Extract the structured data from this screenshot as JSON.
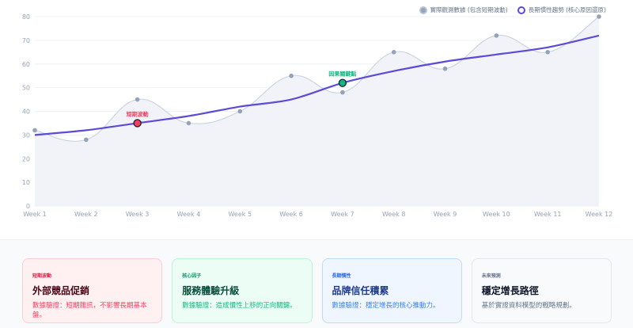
{
  "chart_data": {
    "type": "line",
    "categories": [
      "Week 1",
      "Week 2",
      "Week 3",
      "Week 4",
      "Week 5",
      "Week 6",
      "Week 7",
      "Week 8",
      "Week 9",
      "Week 10",
      "Week 11",
      "Week 12"
    ],
    "yticks": [
      0,
      10,
      20,
      30,
      40,
      50,
      60,
      70,
      80
    ],
    "ylim": [
      0,
      80
    ],
    "grid": true,
    "legend_position": "top-right",
    "series": [
      {
        "name": "實際觀測數據 (包含短期波動)",
        "values": [
          32,
          28,
          45,
          35,
          40,
          55,
          48,
          65,
          58,
          72,
          65,
          80
        ],
        "color": "#94a3b8",
        "style": "smooth-area"
      },
      {
        "name": "長期慣性趨勢 (核心原因還原)",
        "values": [
          30,
          32,
          35,
          38,
          42,
          45,
          52,
          57,
          61,
          64,
          67,
          72
        ],
        "color": "#5b4bd6",
        "style": "line"
      }
    ],
    "annotations": [
      {
        "label": "短期波動",
        "x": "Week 3",
        "y": 35,
        "color": "#f43f5e"
      },
      {
        "label": "因果關鍵點",
        "x": "Week 7",
        "y": 52,
        "color": "#10b981"
      }
    ]
  },
  "cards": [
    {
      "tag": "短期波動",
      "title": "外部競品促銷",
      "desc": "數據驗證：短期雜訊，不影響長期基本盤。"
    },
    {
      "tag": "核心因子",
      "title": "服務體驗升級",
      "desc": "數據驗證：造成慣性上移的正向關鍵。"
    },
    {
      "tag": "長期慣性",
      "title": "品牌信任積累",
      "desc": "數據驗證：穩定增長的核心推動力。"
    },
    {
      "tag": "未來預測",
      "title": "穩定增長路徑",
      "desc": "基於實證資料模型的戰略規劃。"
    }
  ]
}
